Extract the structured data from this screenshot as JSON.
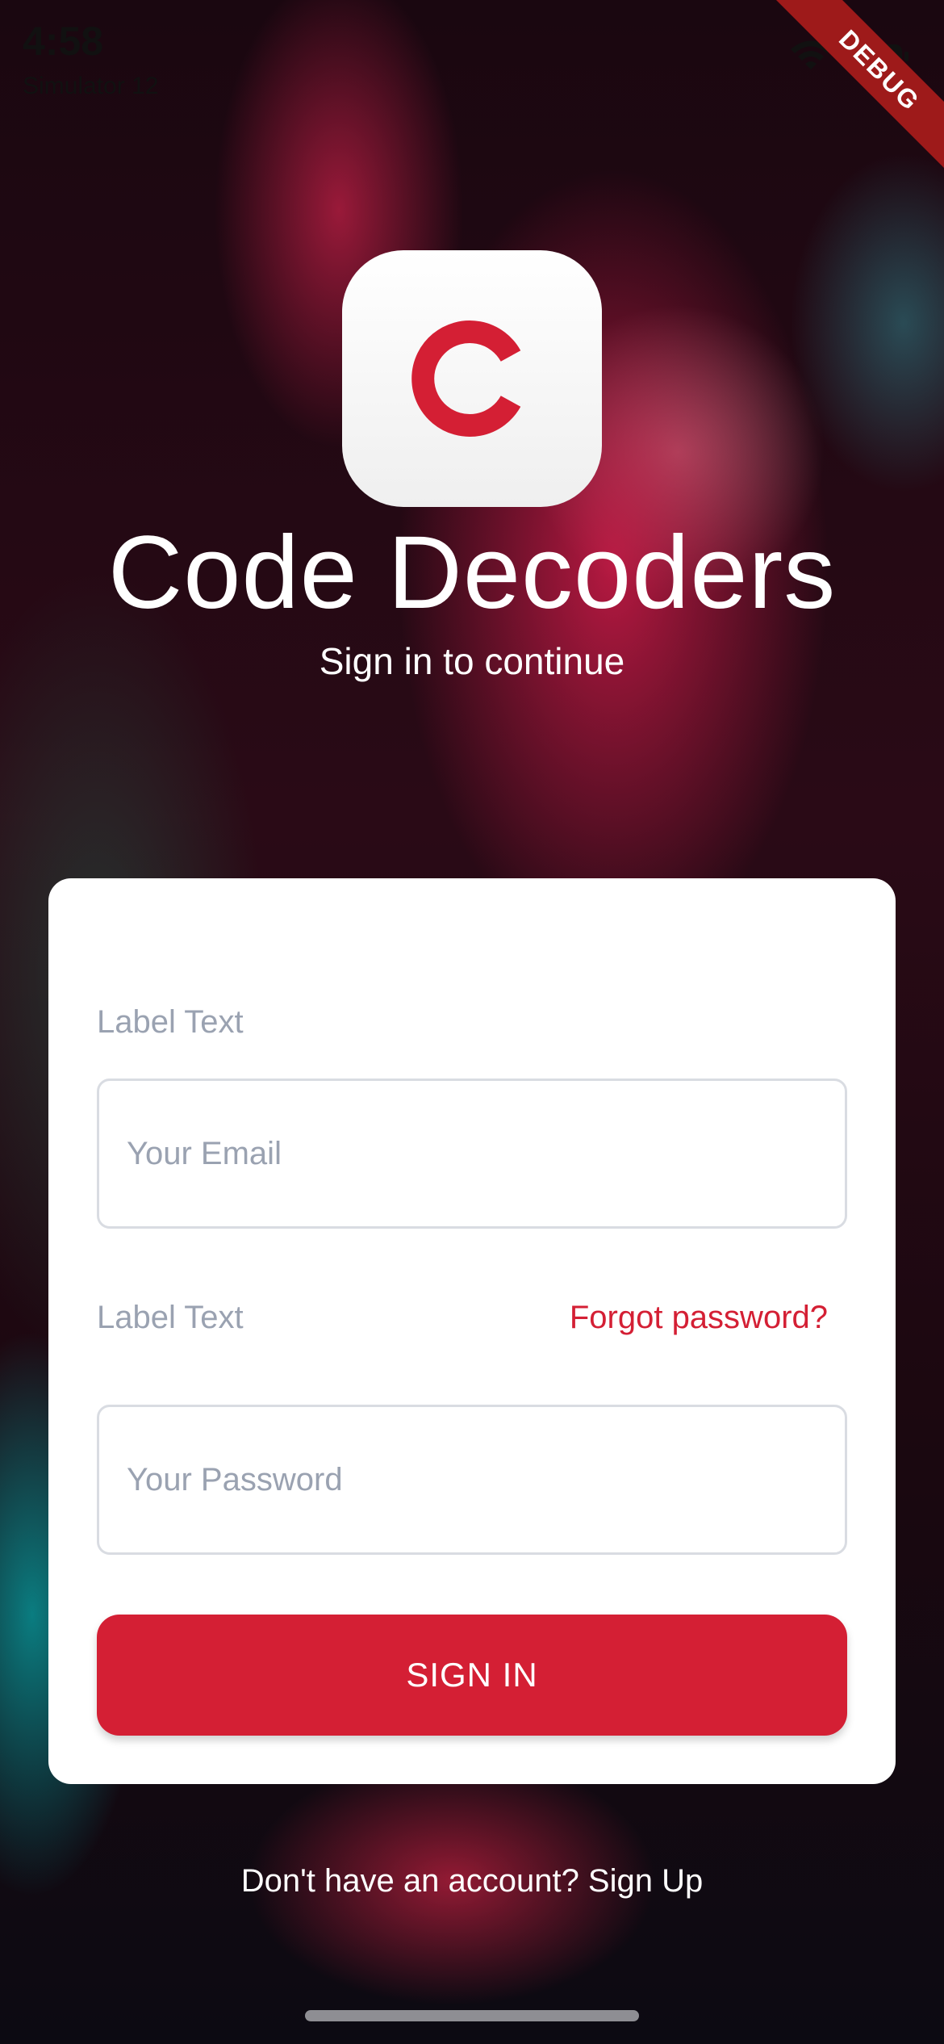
{
  "status_bar": {
    "time": "4:58",
    "subtitle": "Simulator 12"
  },
  "debug_banner": "DEBUG",
  "app": {
    "logo_letter": "C",
    "logo_color": "#d41f34",
    "title": "Code Decoders",
    "subtitle": "Sign in to continue"
  },
  "form": {
    "email_label": "Label Text",
    "email_placeholder": "Your Email",
    "password_label": "Label Text",
    "forgot_password": "Forgot password?",
    "password_placeholder": "Your Password",
    "submit_label": "SIGN IN"
  },
  "footer": {
    "signup_prompt": "Don't have an account? Sign Up"
  },
  "colors": {
    "accent": "#d41f34",
    "label": "#9aa2b1",
    "card": "#ffffff"
  }
}
